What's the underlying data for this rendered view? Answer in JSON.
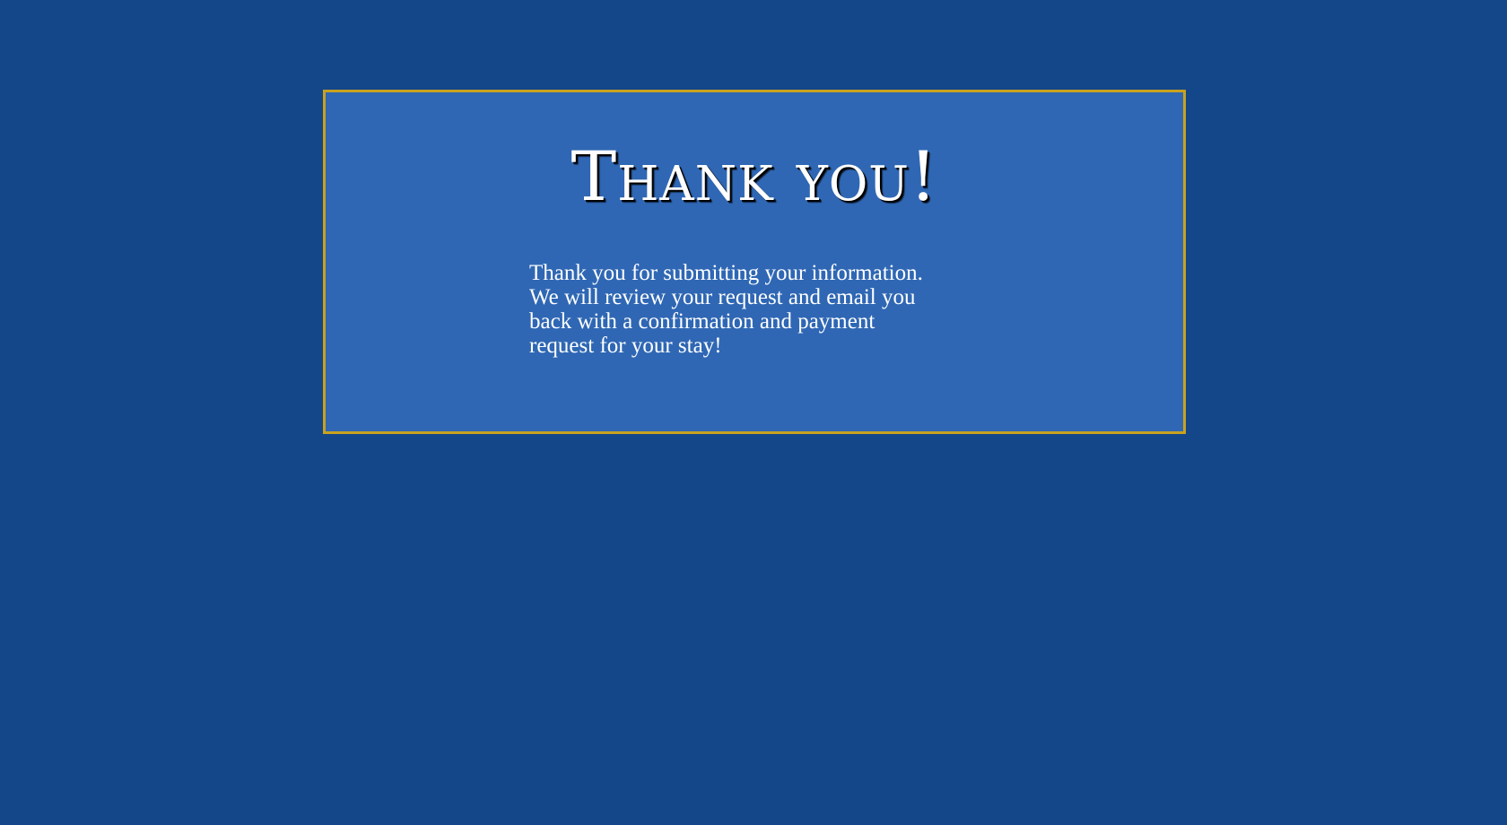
{
  "colors": {
    "background": "#14478a",
    "card": "#2f67b4",
    "card_border": "#c8a21e",
    "text": "#ffffff"
  },
  "card": {
    "heading": "Thank you!",
    "message": "Thank you for submitting your information.\nWe will review your request and email you\nback with a confirmation and payment\nrequest for your stay!"
  }
}
